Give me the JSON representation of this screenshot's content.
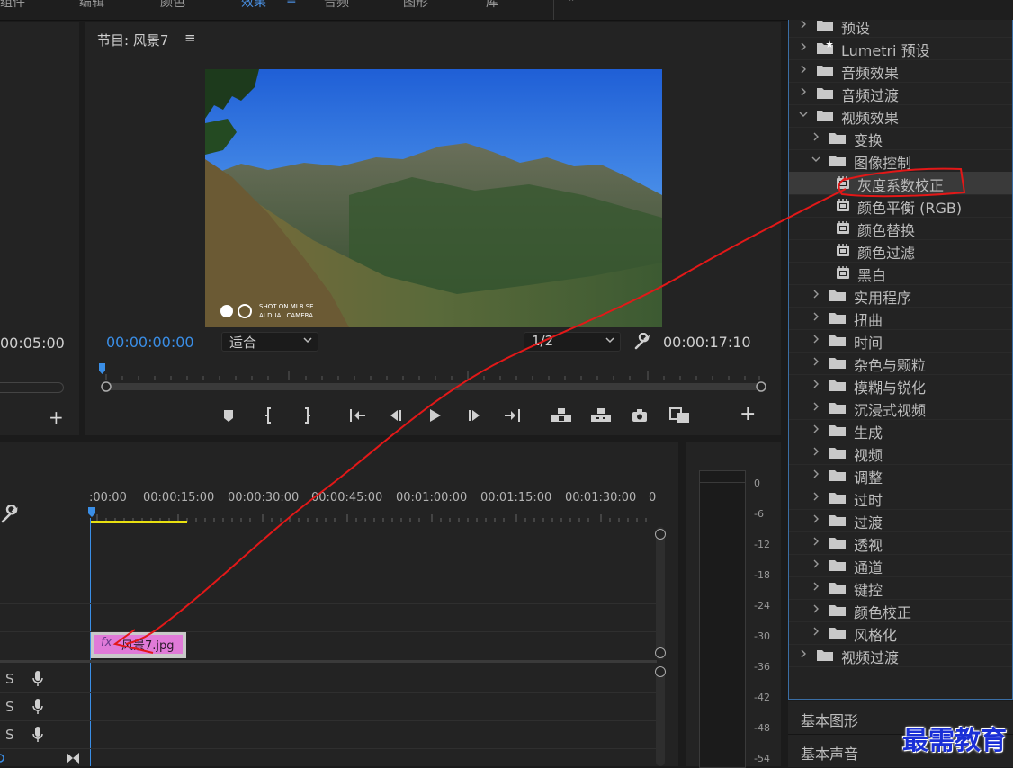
{
  "topbar": {
    "tabs": [
      "组件",
      "编辑",
      "颜色",
      "效果",
      "音频",
      "图形",
      "库"
    ],
    "active_tab": "效果",
    "overflow": "»"
  },
  "left_panel": {
    "timecode": "00:05:00"
  },
  "program_monitor": {
    "title": "节目: 风景7",
    "menu_icon": "≡",
    "current_timecode": "00:00:00:00",
    "fit_select": "适合",
    "resolution_select": "1/2",
    "duration": "00:00:17:10",
    "watermark_line1": "SHOT ON MI 8 SE",
    "watermark_line2": "AI DUAL CAMERA",
    "add_label": "+"
  },
  "effects_panel": {
    "items": [
      {
        "label": "预设",
        "level": 0,
        "type": "folder",
        "expanded": false
      },
      {
        "label": "Lumetri 预设",
        "level": 0,
        "type": "folder-star",
        "expanded": false
      },
      {
        "label": "音频效果",
        "level": 0,
        "type": "folder",
        "expanded": false
      },
      {
        "label": "音频过渡",
        "level": 0,
        "type": "folder",
        "expanded": false
      },
      {
        "label": "视频效果",
        "level": 0,
        "type": "folder",
        "expanded": true
      },
      {
        "label": "变换",
        "level": 1,
        "type": "folder",
        "expanded": false
      },
      {
        "label": "图像控制",
        "level": 1,
        "type": "folder",
        "expanded": true
      },
      {
        "label": "灰度系数校正",
        "level": 2,
        "type": "effect",
        "selected": true
      },
      {
        "label": "颜色平衡 (RGB)",
        "level": 2,
        "type": "effect"
      },
      {
        "label": "颜色替换",
        "level": 2,
        "type": "effect"
      },
      {
        "label": "颜色过滤",
        "level": 2,
        "type": "effect"
      },
      {
        "label": "黑白",
        "level": 2,
        "type": "effect"
      },
      {
        "label": "实用程序",
        "level": 1,
        "type": "folder",
        "expanded": false
      },
      {
        "label": "扭曲",
        "level": 1,
        "type": "folder",
        "expanded": false
      },
      {
        "label": "时间",
        "level": 1,
        "type": "folder",
        "expanded": false
      },
      {
        "label": "杂色与颗粒",
        "level": 1,
        "type": "folder",
        "expanded": false
      },
      {
        "label": "模糊与锐化",
        "level": 1,
        "type": "folder",
        "expanded": false
      },
      {
        "label": "沉浸式视频",
        "level": 1,
        "type": "folder",
        "expanded": false
      },
      {
        "label": "生成",
        "level": 1,
        "type": "folder",
        "expanded": false
      },
      {
        "label": "视频",
        "level": 1,
        "type": "folder",
        "expanded": false
      },
      {
        "label": "调整",
        "level": 1,
        "type": "folder",
        "expanded": false
      },
      {
        "label": "过时",
        "level": 1,
        "type": "folder",
        "expanded": false
      },
      {
        "label": "过渡",
        "level": 1,
        "type": "folder",
        "expanded": false
      },
      {
        "label": "透视",
        "level": 1,
        "type": "folder",
        "expanded": false
      },
      {
        "label": "通道",
        "level": 1,
        "type": "folder",
        "expanded": false
      },
      {
        "label": "键控",
        "level": 1,
        "type": "folder",
        "expanded": false
      },
      {
        "label": "颜色校正",
        "level": 1,
        "type": "folder",
        "expanded": false
      },
      {
        "label": "风格化",
        "level": 1,
        "type": "folder",
        "expanded": false
      },
      {
        "label": "视频过渡",
        "level": 0,
        "type": "folder",
        "expanded": false
      }
    ]
  },
  "side_tabs": {
    "essential_graphics": "基本图形",
    "essential_sound": "基本声音"
  },
  "timeline": {
    "ruler_labels": [
      ":00:00",
      "00:00:15:00",
      "00:00:30:00",
      "00:00:45:00",
      "00:01:00:00",
      "00:01:15:00",
      "00:01:30:00",
      "0"
    ],
    "clip_fx": "fx",
    "clip_name": "风景7.jpg",
    "track_letters": [
      "S",
      "S",
      "S"
    ]
  },
  "audio_meter": {
    "labels": [
      "0",
      "-6",
      "-12",
      "-18",
      "-24",
      "-30",
      "-36",
      "-42",
      "-48",
      "-54"
    ]
  },
  "watermark_text": "最需教育",
  "colors": {
    "accent_blue": "#3a8ee6",
    "clip_pink": "#e07ad8",
    "annotation_red": "#e31818",
    "in_out_yellow": "#e8e010",
    "panel_border": "#3a6ea5"
  }
}
